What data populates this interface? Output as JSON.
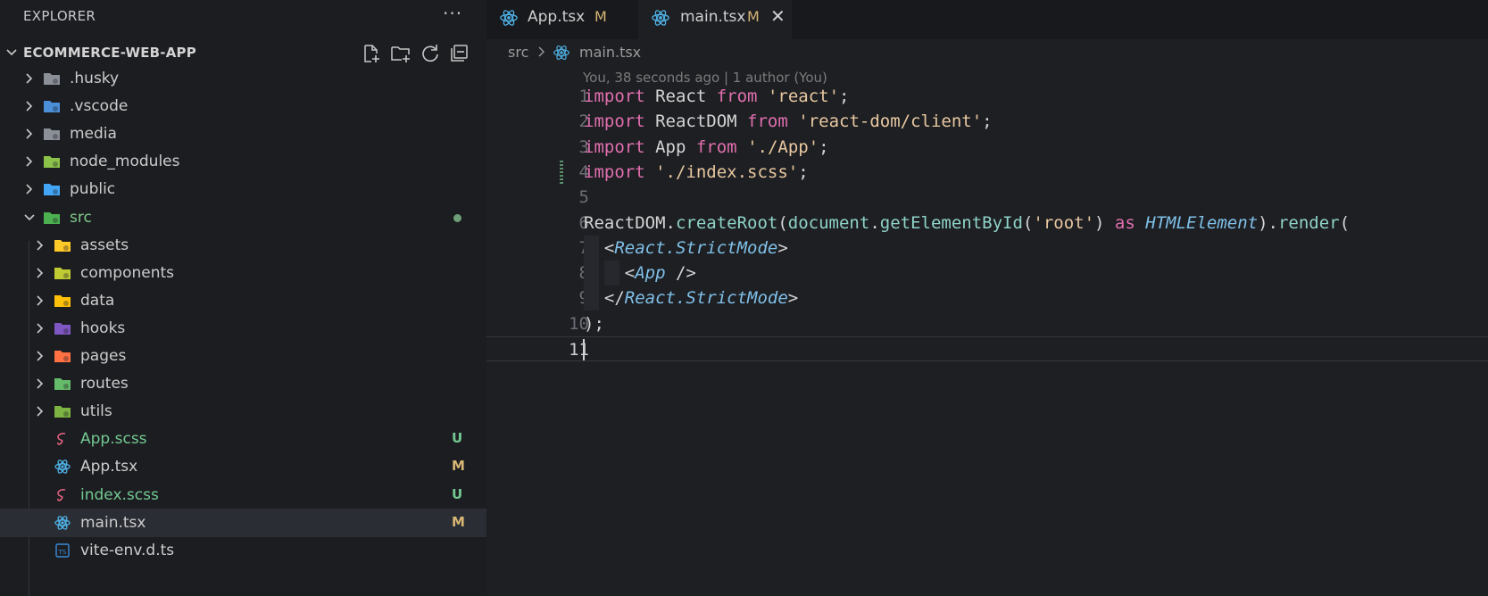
{
  "explorer": {
    "title": "EXPLORER",
    "more": "···",
    "root": "ECOMMERCE-WEB-APP",
    "actions": [
      "new-file-icon",
      "new-folder-icon",
      "refresh-icon",
      "collapse-all-icon"
    ]
  },
  "tree": [
    {
      "label": ".husky",
      "type": "folder",
      "icon": "husky-folder-icon",
      "color": "#8a8f98"
    },
    {
      "label": ".vscode",
      "type": "folder",
      "icon": "vscode-folder-icon",
      "color": "#4a8fd8"
    },
    {
      "label": "media",
      "type": "folder",
      "icon": "folder-icon",
      "color": "#8a8f98"
    },
    {
      "label": "node_modules",
      "type": "folder",
      "icon": "node-folder-icon",
      "color": "#8bc34a"
    },
    {
      "label": "public",
      "type": "folder",
      "icon": "public-folder-icon",
      "color": "#42a5f5"
    },
    {
      "label": "src",
      "type": "folder-open",
      "icon": "src-folder-icon",
      "color": "#4caf50",
      "modified_dot": true
    },
    {
      "label": "assets",
      "type": "folder",
      "icon": "assets-folder-icon",
      "color": "#ffca28"
    },
    {
      "label": "components",
      "type": "folder",
      "icon": "components-folder-icon",
      "color": "#c0ca33"
    },
    {
      "label": "data",
      "type": "folder",
      "icon": "data-folder-icon",
      "color": "#ffc107"
    },
    {
      "label": "hooks",
      "type": "folder",
      "icon": "hooks-folder-icon",
      "color": "#7e57c2"
    },
    {
      "label": "pages",
      "type": "folder",
      "icon": "pages-folder-icon",
      "color": "#ff7043"
    },
    {
      "label": "routes",
      "type": "folder",
      "icon": "routes-folder-icon",
      "color": "#66bb6a"
    },
    {
      "label": "utils",
      "type": "folder",
      "icon": "utils-folder-icon",
      "color": "#7cb342"
    },
    {
      "label": "App.scss",
      "type": "file",
      "icon": "sass-icon",
      "color": "#e06080",
      "badge": "U"
    },
    {
      "label": "App.tsx",
      "type": "file",
      "icon": "react-icon",
      "color": "#4fb3e8",
      "badge": "M"
    },
    {
      "label": "index.scss",
      "type": "file",
      "icon": "sass-icon",
      "color": "#e06080",
      "badge": "U"
    },
    {
      "label": "main.tsx",
      "type": "file",
      "icon": "react-icon",
      "color": "#4fb3e8",
      "badge": "M",
      "selected": true
    },
    {
      "label": "vite-env.d.ts",
      "type": "file",
      "icon": "typescript-icon",
      "color": "#3b8bd6"
    }
  ],
  "tabs": [
    {
      "label": "App.tsx",
      "status": "M",
      "active": false
    },
    {
      "label": "main.tsx",
      "status": "M",
      "active": true,
      "close": "✕"
    }
  ],
  "breadcrumb": {
    "folder": "src",
    "file": "main.tsx"
  },
  "blame": "You, 38 seconds ago | 1 author (You)",
  "code": [
    {
      "n": "1",
      "tokens": [
        [
          "kw",
          "import"
        ],
        [
          "p",
          " React "
        ],
        [
          "kw",
          "from"
        ],
        [
          "p",
          " "
        ],
        [
          "str",
          "'react'"
        ],
        [
          "p",
          ";"
        ]
      ]
    },
    {
      "n": "2",
      "tokens": [
        [
          "kw",
          "import"
        ],
        [
          "p",
          " ReactDOM "
        ],
        [
          "kw",
          "from"
        ],
        [
          "p",
          " "
        ],
        [
          "str",
          "'react-dom/client'"
        ],
        [
          "p",
          ";"
        ]
      ]
    },
    {
      "n": "3",
      "tokens": [
        [
          "kw",
          "import"
        ],
        [
          "p",
          " App "
        ],
        [
          "kw",
          "from"
        ],
        [
          "p",
          " "
        ],
        [
          "str",
          "'./App'"
        ],
        [
          "p",
          ";"
        ]
      ]
    },
    {
      "n": "4",
      "tokens": [
        [
          "kw",
          "import"
        ],
        [
          "p",
          " "
        ],
        [
          "str",
          "'./index.scss'"
        ],
        [
          "p",
          ";"
        ]
      ]
    },
    {
      "n": "5",
      "tokens": []
    },
    {
      "n": "6",
      "tokens": [
        [
          "p",
          "ReactDOM."
        ],
        [
          "fn",
          "createRoot"
        ],
        [
          "p",
          "("
        ],
        [
          "var",
          "document"
        ],
        [
          "p",
          "."
        ],
        [
          "fn",
          "getElementById"
        ],
        [
          "p",
          "("
        ],
        [
          "str",
          "'root'"
        ],
        [
          "p",
          ") "
        ],
        [
          "kw",
          "as"
        ],
        [
          "p",
          " "
        ],
        [
          "type",
          "HTMLElement"
        ],
        [
          "p",
          ")."
        ],
        [
          "fn",
          "render"
        ],
        [
          "p",
          "("
        ]
      ]
    },
    {
      "n": "7",
      "tokens": [
        [
          "p",
          "  <"
        ],
        [
          "type",
          "React.StrictMode"
        ],
        [
          "p",
          ">"
        ]
      ]
    },
    {
      "n": "8",
      "tokens": [
        [
          "p",
          "    <"
        ],
        [
          "type",
          "App"
        ],
        [
          "p",
          " />"
        ]
      ]
    },
    {
      "n": "9",
      "tokens": [
        [
          "p",
          "  </"
        ],
        [
          "type",
          "React.StrictMode"
        ],
        [
          "p",
          ">"
        ]
      ]
    },
    {
      "n": "10",
      "tokens": [
        [
          "p",
          ");"
        ]
      ]
    },
    {
      "n": "11",
      "tokens": [],
      "current": true
    }
  ]
}
